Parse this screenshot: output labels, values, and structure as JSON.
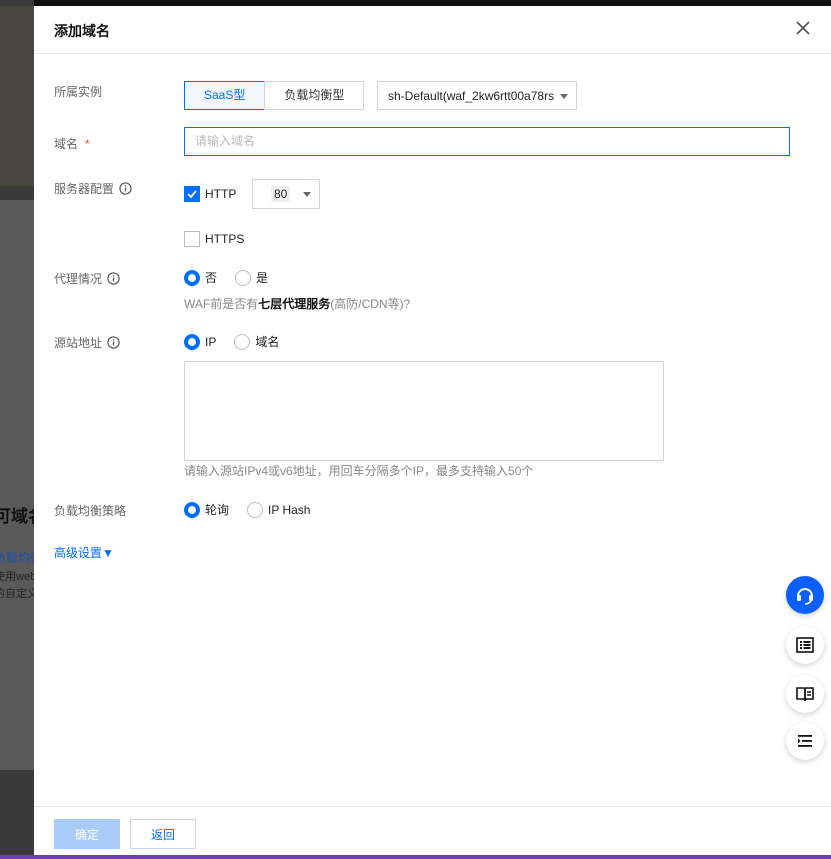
{
  "background": {
    "fragment_big": "可域名",
    "fragment_link": "负载均衡",
    "fragment_line1": "使用web",
    "fragment_line2": "的自定义"
  },
  "dialog": {
    "title": "添加域名",
    "instance": {
      "label": "所属实例",
      "options": [
        "SaaS型",
        "负载均衡型"
      ],
      "selected": "SaaS型",
      "instance_value": "sh-Default(waf_2kw6rtt00a78rs"
    },
    "domain": {
      "label": "域名",
      "required_mark": "*",
      "placeholder": "请输入域名",
      "value": ""
    },
    "server": {
      "label": "服务器配置",
      "http_label": "HTTP",
      "http_checked": true,
      "http_port": "80",
      "https_label": "HTTPS",
      "https_checked": false
    },
    "proxy": {
      "label": "代理情况",
      "options": [
        "否",
        "是"
      ],
      "selected": "否",
      "hint_prefix": "WAF前是否有",
      "hint_bold": "七层代理服务",
      "hint_suffix": "(高防/CDN等)?"
    },
    "origin": {
      "label": "源站地址",
      "options": [
        "IP",
        "域名"
      ],
      "selected": "IP",
      "textarea_value": "",
      "hint": "请输入源站IPv4或v6地址，用回车分隔多个IP，最多支持输入50个"
    },
    "lb_policy": {
      "label": "负载均衡策略",
      "options": [
        "轮询",
        "IP Hash"
      ],
      "selected": "轮询"
    },
    "advanced_link": "高级设置▼",
    "footer": {
      "confirm_label": "确定",
      "back_label": "返回"
    }
  },
  "floating_buttons": [
    "headset-icon",
    "list-icon",
    "book-icon",
    "outline-icon"
  ],
  "colors": {
    "accent": "#006eff",
    "required": "#e54545",
    "disabled_primary": "#a9cbf8"
  }
}
